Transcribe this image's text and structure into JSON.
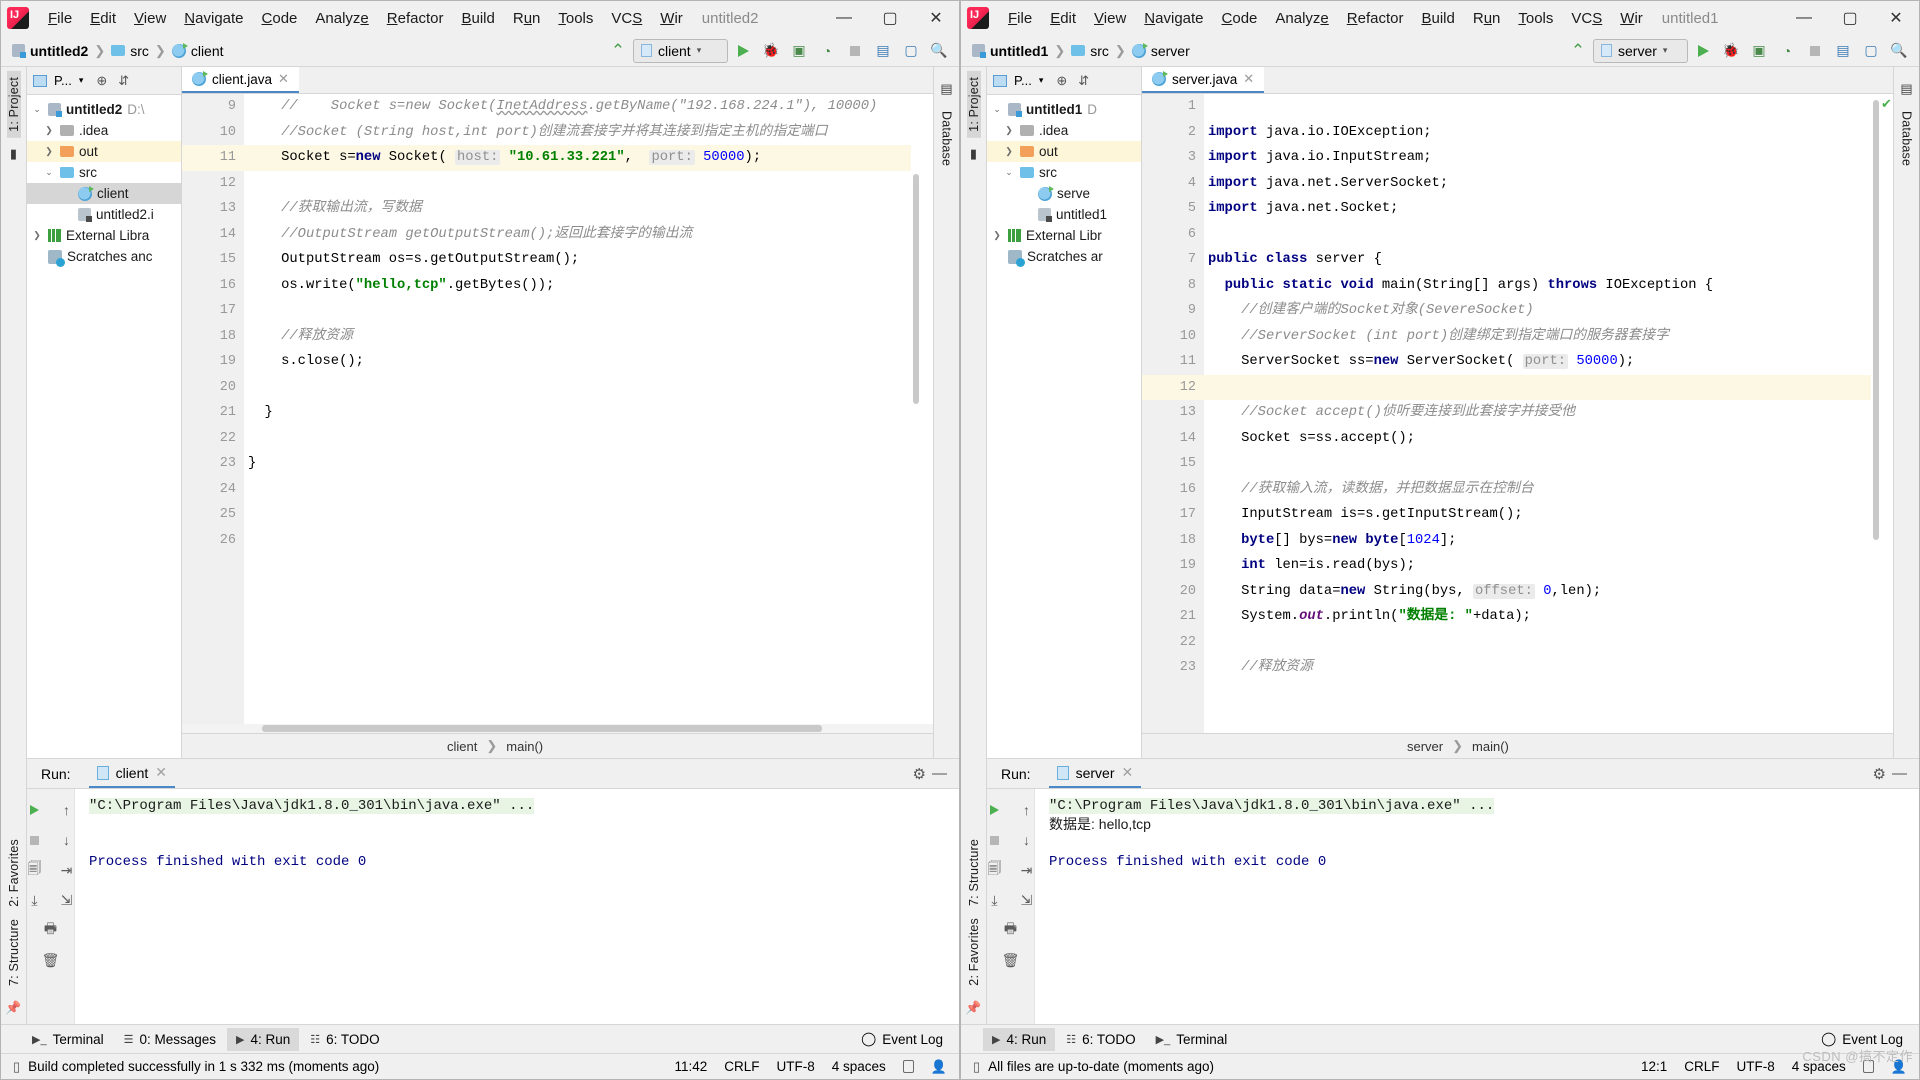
{
  "menu": {
    "items": [
      "File",
      "Edit",
      "View",
      "Navigate",
      "Code",
      "Analyze",
      "Refactor",
      "Build",
      "Run",
      "Tools",
      "VCS",
      "Wir"
    ],
    "minimize": "—",
    "maximize": "▢",
    "close": "✕"
  },
  "left": {
    "window_title": "untitled2",
    "breadcrumbs": [
      "untitled2",
      "src",
      "client"
    ],
    "run_config": "client",
    "tree": {
      "header_label": "P...",
      "items": [
        {
          "label": "untitled2",
          "suffix": "D:\\",
          "arrow": "v",
          "icon": "module-icon",
          "bold": true,
          "state": "normal"
        },
        {
          "label": ".idea",
          "suffix": "",
          "arrow": ">",
          "icon": "folder-grey-icon",
          "bold": false,
          "state": "normal"
        },
        {
          "label": "out",
          "suffix": "",
          "arrow": ">",
          "icon": "folder-orange-icon",
          "bold": false,
          "state": "highlight"
        },
        {
          "label": "src",
          "suffix": "",
          "arrow": "v",
          "icon": "folder-blue-icon",
          "bold": false,
          "state": "normal"
        },
        {
          "label": "client",
          "suffix": "",
          "arrow": "",
          "icon": "java-class-icon",
          "bold": false,
          "state": "selected"
        },
        {
          "label": "untitled2.i",
          "suffix": "",
          "arrow": "",
          "icon": "iml-file-icon",
          "bold": false,
          "state": "normal"
        },
        {
          "label": "External Libra",
          "suffix": "",
          "arrow": ">",
          "icon": "library-icon",
          "bold": false,
          "state": "normal"
        },
        {
          "label": "Scratches anc",
          "suffix": "",
          "arrow": "",
          "icon": "scratches-icon",
          "bold": false,
          "state": "normal"
        }
      ]
    },
    "tab": {
      "label": "client.java",
      "close": "✕"
    },
    "editor": {
      "first_line": 9,
      "lines": [
        {
          "n": 9,
          "html": "    <span class='cmt'>//    Socket s=new Socket(<span class='squig'>InetAddress</span>.getByName(\"192.168.224.1\"), 10000)</span>",
          "cur": false,
          "marker": "",
          "fold": false
        },
        {
          "n": 10,
          "html": "    <span class='cmt'>//Socket (String host,int port)创建流套接字并将其连接到指定主机的指定端口</span>",
          "cur": false,
          "marker": "",
          "fold": true
        },
        {
          "n": 11,
          "html": "    Socket s=<span class='kw'>new</span> Socket( <span class='hint'>host:</span> <span class='str'>\"10.61.33.221\"</span>,  <span class='hint'>port:</span> <span class='num'>50000</span>);",
          "cur": true,
          "marker": "",
          "fold": false
        },
        {
          "n": 12,
          "html": "",
          "cur": false,
          "marker": "",
          "fold": false
        },
        {
          "n": 13,
          "html": "    <span class='cmt'>//获取输出流，写数据</span>",
          "cur": false,
          "marker": "",
          "fold": true
        },
        {
          "n": 14,
          "html": "    <span class='cmt'>//OutputStream getOutputStream();返回此套接字的输出流</span>",
          "cur": false,
          "marker": "",
          "fold": true
        },
        {
          "n": 15,
          "html": "    OutputStream os=s.getOutputStream();",
          "cur": false,
          "marker": "",
          "fold": false
        },
        {
          "n": 16,
          "html": "    os.write(<span class='str'>\"hello,tcp\"</span>.getBytes());",
          "cur": false,
          "marker": "",
          "fold": false
        },
        {
          "n": 17,
          "html": "",
          "cur": false,
          "marker": "",
          "fold": false
        },
        {
          "n": 18,
          "html": "    <span class='cmt'>//释放资源</span>",
          "cur": false,
          "marker": "",
          "fold": false
        },
        {
          "n": 19,
          "html": "    s.close();",
          "cur": false,
          "marker": "",
          "fold": false
        },
        {
          "n": 20,
          "html": "",
          "cur": false,
          "marker": "",
          "fold": false
        },
        {
          "n": 21,
          "html": "  }",
          "cur": false,
          "marker": "",
          "fold": true
        },
        {
          "n": 22,
          "html": "",
          "cur": false,
          "marker": "",
          "fold": false
        },
        {
          "n": 23,
          "html": "}",
          "cur": false,
          "marker": "",
          "fold": false
        },
        {
          "n": 24,
          "html": "",
          "cur": false,
          "marker": "",
          "fold": false
        },
        {
          "n": 25,
          "html": "",
          "cur": false,
          "marker": "",
          "fold": false
        },
        {
          "n": 26,
          "html": "",
          "cur": false,
          "marker": "",
          "fold": false
        }
      ]
    },
    "editor_breadcrumb": [
      "client",
      "main()"
    ],
    "run": {
      "label": "Run:",
      "tab": "client",
      "command": "\"C:\\Program Files\\Java\\jdk1.8.0_301\\bin\\java.exe\" ...",
      "output_zh": "",
      "result": "Process finished with exit code 0"
    },
    "toolwindows": [
      {
        "label": "Terminal",
        "icon": "terminal-icon",
        "active": false
      },
      {
        "label": "0: Messages",
        "icon": "messages-icon",
        "active": false
      },
      {
        "label": "4: Run",
        "icon": "run-icon",
        "active": true
      },
      {
        "label": "6: TODO",
        "icon": "todo-icon",
        "active": false
      }
    ],
    "event_log": "Event Log",
    "status": {
      "message": "Build completed successfully in 1 s 332 ms (moments ago)",
      "caret": "11:42",
      "line_sep": "CRLF",
      "encoding": "UTF-8",
      "indent": "4 spaces"
    },
    "rails": {
      "left_top": "1: Project",
      "left_bottom": [
        "2: Favorites",
        "7: Structure"
      ],
      "right": "Database"
    }
  },
  "right": {
    "window_title": "untitled1",
    "breadcrumbs": [
      "untitled1",
      "src",
      "server"
    ],
    "run_config": "server",
    "tree": {
      "header_label": "P...",
      "items": [
        {
          "label": "untitled1",
          "suffix": "D",
          "arrow": "v",
          "icon": "module-icon",
          "bold": true,
          "state": "normal"
        },
        {
          "label": ".idea",
          "suffix": "",
          "arrow": ">",
          "icon": "folder-grey-icon",
          "bold": false,
          "state": "normal"
        },
        {
          "label": "out",
          "suffix": "",
          "arrow": ">",
          "icon": "folder-orange-icon",
          "bold": false,
          "state": "highlight"
        },
        {
          "label": "src",
          "suffix": "",
          "arrow": "v",
          "icon": "folder-blue-icon",
          "bold": false,
          "state": "normal"
        },
        {
          "label": "serve",
          "suffix": "",
          "arrow": "",
          "icon": "java-class-icon",
          "bold": false,
          "state": "normal"
        },
        {
          "label": "untitled1",
          "suffix": "",
          "arrow": "",
          "icon": "iml-file-icon",
          "bold": false,
          "state": "normal"
        },
        {
          "label": "External Libr",
          "suffix": "",
          "arrow": ">",
          "icon": "library-icon",
          "bold": false,
          "state": "normal"
        },
        {
          "label": "Scratches ar",
          "suffix": "",
          "arrow": "",
          "icon": "scratches-icon",
          "bold": false,
          "state": "normal"
        }
      ]
    },
    "tab": {
      "label": "server.java",
      "close": "✕"
    },
    "editor": {
      "first_line": 1,
      "lines": [
        {
          "n": 1,
          "html": "",
          "cur": false,
          "marker": "",
          "fold": false
        },
        {
          "n": 2,
          "html": "<span class='kw'>import</span> java.io.IOException;",
          "cur": false,
          "marker": "",
          "fold": true
        },
        {
          "n": 3,
          "html": "<span class='kw'>import</span> java.io.InputStream;",
          "cur": false,
          "marker": "",
          "fold": false
        },
        {
          "n": 4,
          "html": "<span class='kw'>import</span> java.net.ServerSocket;",
          "cur": false,
          "marker": "",
          "fold": false
        },
        {
          "n": 5,
          "html": "<span class='kw'>import</span> java.net.Socket;",
          "cur": false,
          "marker": "",
          "fold": true
        },
        {
          "n": 6,
          "html": "",
          "cur": false,
          "marker": "",
          "fold": false
        },
        {
          "n": 7,
          "html": "<span class='kw'>public class</span> server {",
          "cur": false,
          "marker": "run",
          "fold": false
        },
        {
          "n": 8,
          "html": "  <span class='kw'>public static void</span> main(String[] args) <span class='kw'>throws</span> IOException {",
          "cur": false,
          "marker": "run",
          "fold": true
        },
        {
          "n": 9,
          "html": "    <span class='cmt'>//创建客户端的Socket对象(SevereSocket)</span>",
          "cur": false,
          "marker": "",
          "fold": true
        },
        {
          "n": 10,
          "html": "    <span class='cmt'>//ServerSocket (int port)创建绑定到指定端口的服务器套接字</span>",
          "cur": false,
          "marker": "",
          "fold": true
        },
        {
          "n": 11,
          "html": "    ServerSocket ss=<span class='kw'>new</span> ServerSocket( <span class='hint'>port:</span> <span class='num'>50000</span>);",
          "cur": false,
          "marker": "bulb",
          "fold": false
        },
        {
          "n": 12,
          "html": "",
          "cur": true,
          "marker": "",
          "fold": false
        },
        {
          "n": 13,
          "html": "    <span class='cmt'>//Socket accept()侦听要连接到此套接字并接受他</span>",
          "cur": false,
          "marker": "",
          "fold": false
        },
        {
          "n": 14,
          "html": "    Socket s=ss.accept();",
          "cur": false,
          "marker": "",
          "fold": false
        },
        {
          "n": 15,
          "html": "",
          "cur": false,
          "marker": "",
          "fold": false
        },
        {
          "n": 16,
          "html": "    <span class='cmt'>//获取输入流，读数据，并把数据显示在控制台</span>",
          "cur": false,
          "marker": "",
          "fold": false
        },
        {
          "n": 17,
          "html": "    InputStream is=s.getInputStream();",
          "cur": false,
          "marker": "",
          "fold": false
        },
        {
          "n": 18,
          "html": "    <span class='kw'>byte</span>[] bys=<span class='kw'>new</span> <span class='kw'>byte</span>[<span class='num'>1024</span>];",
          "cur": false,
          "marker": "",
          "fold": false
        },
        {
          "n": 19,
          "html": "    <span class='kw'>int</span> len=is.read(bys);",
          "cur": false,
          "marker": "",
          "fold": false
        },
        {
          "n": 20,
          "html": "    String data=<span class='kw'>new</span> String(bys, <span class='hint'>offset:</span> <span class='num'>0</span>,len);",
          "cur": false,
          "marker": "",
          "fold": false
        },
        {
          "n": 21,
          "html": "    System.<span class='fld'>out</span>.println(<span class='str'>\"数据是: \"</span>+data);",
          "cur": false,
          "marker": "",
          "fold": false
        },
        {
          "n": 22,
          "html": "",
          "cur": false,
          "marker": "",
          "fold": false
        },
        {
          "n": 23,
          "html": "    <span class='cmt'>//释放资源</span>",
          "cur": false,
          "marker": "",
          "fold": false
        }
      ]
    },
    "editor_breadcrumb": [
      "server",
      "main()"
    ],
    "run": {
      "label": "Run:",
      "tab": "server",
      "command": "\"C:\\Program Files\\Java\\jdk1.8.0_301\\bin\\java.exe\" ...",
      "output_zh": "数据是: hello,tcp",
      "result": "Process finished with exit code 0"
    },
    "toolwindows": [
      {
        "label": "4: Run",
        "icon": "run-icon",
        "active": true
      },
      {
        "label": "6: TODO",
        "icon": "todo-icon",
        "active": false
      },
      {
        "label": "Terminal",
        "icon": "terminal-icon",
        "active": false
      }
    ],
    "event_log": "Event Log",
    "status": {
      "message": "All files are up-to-date (moments ago)",
      "caret": "12:1",
      "line_sep": "CRLF",
      "encoding": "UTF-8",
      "indent": "4 spaces"
    },
    "rails": {
      "left_top": "1: Project",
      "left_bottom": [
        "7: Structure",
        "2: Favorites"
      ],
      "right": "Database"
    },
    "watermark": "CSDN @搞不定作"
  },
  "colors": {
    "accent": "#4a88c7",
    "run_green": "#4caf50",
    "current_line": "#fcf8e3",
    "highlight": "#fdf6d8"
  }
}
